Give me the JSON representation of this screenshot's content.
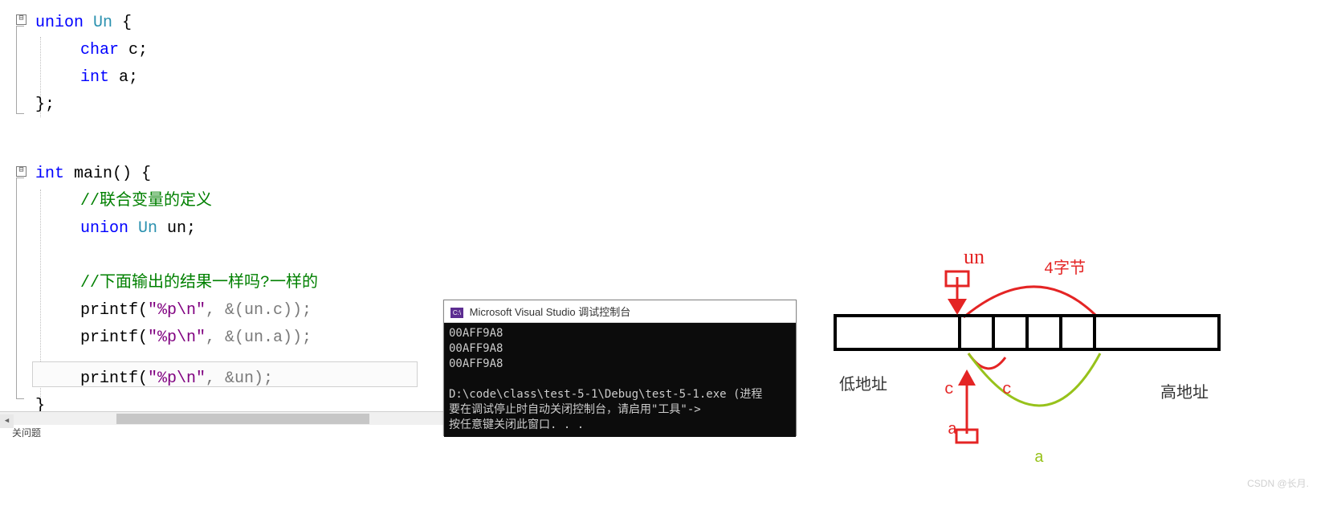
{
  "code": {
    "l1_union": "union",
    "l1_type": "Un",
    "l1_brace": " {",
    "l2_char": "char",
    "l2_var": " c;",
    "l3_int": "int",
    "l3_var": " a;",
    "l4": "};",
    "l6_int": "int",
    "l6_main": " main() {",
    "l7_comment": "//联合变量的定义",
    "l8_union": "union",
    "l8_type": " Un",
    "l8_var": " un;",
    "l10_comment": "//下面输出的结果一样吗?一样的",
    "l11_printf": "printf(",
    "l11_str": "\"%p\\n\"",
    "l11_rest": ", &(un.c));",
    "l12_printf": "printf(",
    "l12_str": "\"%p\\n\"",
    "l12_rest": ", &(un.a));",
    "l13_printf": "printf(",
    "l13_str": "\"%p\\n\"",
    "l13_rest": ", &un);",
    "l14": "}"
  },
  "tab": "关问题",
  "console": {
    "title": "Microsoft Visual Studio 调试控制台",
    "out1": "00AFF9A8",
    "out2": "00AFF9A8",
    "out3": "00AFF9A8",
    "path": "D:\\code\\class\\test-5-1\\Debug\\test-5-1.exe (进程",
    "msg1": "要在调试停止时自动关闭控制台，请启用\"工具\"->",
    "msg2": "按任意键关闭此窗口. . ."
  },
  "diagram": {
    "un": "un",
    "bytes4": "4字节",
    "low": "低地址",
    "high": "高地址",
    "c1": "c",
    "c2": "c",
    "a1": "a",
    "a2": "a"
  },
  "watermark": "CSDN @长月."
}
